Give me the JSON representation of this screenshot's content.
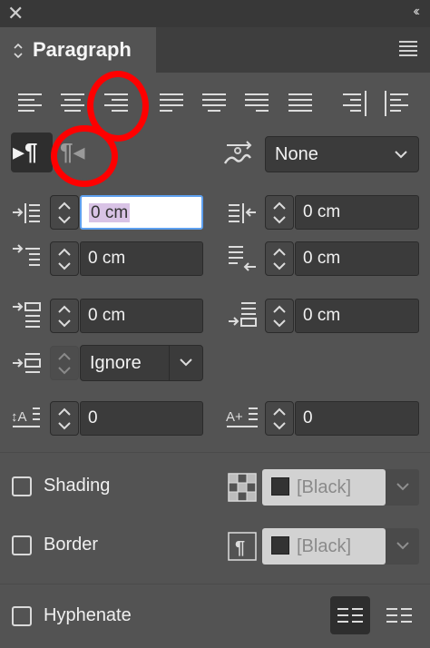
{
  "window": {
    "close_glyph": "✕",
    "collapse_glyph": "‹‹"
  },
  "panel": {
    "title": "Paragraph"
  },
  "alignment_buttons": [
    "align-left",
    "align-center",
    "align-right",
    "align-left-justify",
    "align-center-justify",
    "align-right-justify",
    "align-full-justify",
    "align-toward-spine",
    "align-away-from-spine"
  ],
  "direction": {
    "ltr_glyph": "▸¶",
    "rtl_glyph": "¶◂"
  },
  "composer": {
    "value": "None"
  },
  "indents": {
    "left_indent": "0 cm",
    "right_indent": "0 cm",
    "first_line_indent": "0 cm",
    "last_line_right_indent": "0 cm",
    "space_before": "0 cm",
    "space_after": "0 cm",
    "align_to_grid": "Ignore",
    "drop_cap_lines": "0",
    "drop_cap_chars": "0"
  },
  "shading": {
    "label": "Shading",
    "swatch": "[Black]",
    "checked": false
  },
  "border": {
    "label": "Border",
    "swatch": "[Black]",
    "checked": false
  },
  "hyphenate": {
    "label": "Hyphenate",
    "checked": false
  },
  "colors": {
    "panel": "#535353",
    "field": "#3b3b3b",
    "highlight": "#ff0000",
    "focus": "#5ea0ef"
  }
}
